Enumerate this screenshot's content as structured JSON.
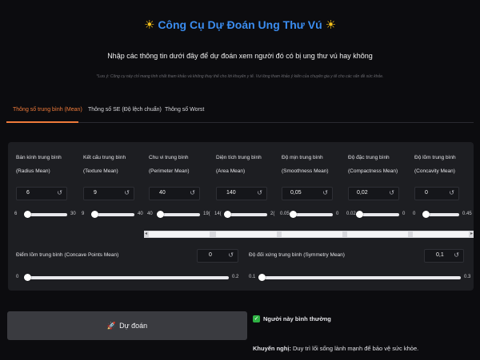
{
  "header": {
    "title": "Công Cụ Dự Đoán Ung Thư Vú",
    "subtitle": "Nhập các thông tin dưới đây để dự đoán xem người đó có bị ung thư vú hay không",
    "note": "*Lưu ý: Công cụ này chỉ mang tính chất tham khảo và không thay thế cho lời khuyên y tế. Vui lòng tham khảo ý kiến của chuyên gia y tế cho các vấn đề sức khỏe."
  },
  "tabs": [
    {
      "label": "Thông số trung bình (Mean)",
      "active": true
    },
    {
      "label": "Thông số SE (Độ lệch chuẩn)",
      "active": false
    },
    {
      "label": "Thông số Worst",
      "active": false
    }
  ],
  "fields_row1": [
    {
      "label1": "Bán kính trung bình",
      "label2": "(Radius Mean)",
      "value": "6",
      "min": "6",
      "max": "30",
      "fraction": 0.0
    },
    {
      "label1": "Kết cấu trung bình",
      "label2": "(Texture Mean)",
      "value": "9",
      "min": "9",
      "max": "40",
      "fraction": 0.0
    },
    {
      "label1": "Chu vi trung bình",
      "label2": "(Perimeter Mean)",
      "value": "40",
      "min": "40",
      "max": "19(",
      "fraction": 0.0
    },
    {
      "label1": "Diện tích trung bình",
      "label2": "(Area Mean)",
      "value": "140",
      "min": "14(",
      "max": "2(",
      "fraction": 0.0
    },
    {
      "label1": "Độ mịn trung bình",
      "label2": "(Smoothness Mean)",
      "value": "0,05",
      "min": "0.05",
      "max": "0",
      "fraction": 0.0
    },
    {
      "label1": "Độ đặc trung bình",
      "label2": "(Compactness Mean)",
      "value": "0,02",
      "min": "0.02",
      "max": "0",
      "fraction": 0.0
    },
    {
      "label1": "Độ lõm trung bình",
      "label2": "(Concavity Mean)",
      "value": "0",
      "min": "0",
      "max": "0.45",
      "fraction": 0.0
    }
  ],
  "fields_row2": [
    {
      "label": "Điểm lõm trung bình (Concave Points Mean)",
      "value": "0",
      "min": "0",
      "max": "0.2",
      "fraction": 0.0
    },
    {
      "label": "Độ đối xứng trung bình (Symmetry Mean)",
      "value": "0,1",
      "min": "0.1",
      "max": "0.3",
      "fraction": 0.0
    }
  ],
  "reset_symbol": "↺",
  "predict_button": {
    "icon": "🚀",
    "label": "Dự đoán"
  },
  "result": {
    "check": "✓",
    "text": "Người này bình thường"
  },
  "advice": {
    "prefix": "Khuyến nghị:",
    "text": " Duy trì lối sống lành mạnh để bảo vệ sức khỏe."
  },
  "colors": {
    "accent": "#f07b3a",
    "title": "#3b8df0",
    "success": "#2fb344"
  }
}
